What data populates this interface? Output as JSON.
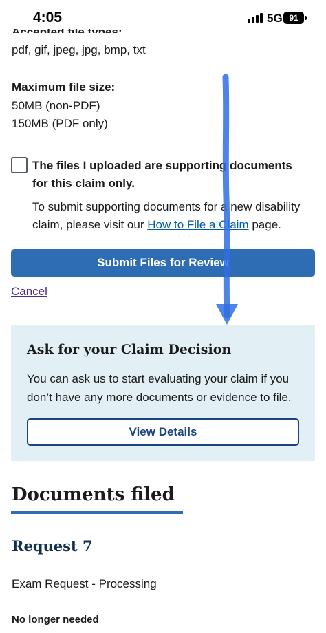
{
  "status_bar": {
    "time": "4:05",
    "network": "5G",
    "battery": "91"
  },
  "upload": {
    "accepted_types_label": "Accepted file types:",
    "accepted_types_value": "pdf, gif, jpeg, jpg, bmp, txt",
    "max_size_label": "Maximum file size:",
    "max_size_non_pdf": "50MB (non-PDF)",
    "max_size_pdf": "150MB (PDF only)",
    "checkbox_label": "The files I uploaded are supporting documents for this claim only.",
    "hint_prefix": "To submit supporting documents for a new disability claim, please visit our ",
    "hint_link": "How to File a Claim",
    "hint_suffix": " page.",
    "submit_label": "Submit Files for Review",
    "cancel_label": "Cancel"
  },
  "claim_decision": {
    "title": "Ask for your Claim Decision",
    "body": "You can ask us to start evaluating your claim if you don’t have any more documents or evidence to file.",
    "button_label": "View Details"
  },
  "documents": {
    "heading": "Documents filed",
    "request_title": "Request 7",
    "request_status": "Exam Request - Processing",
    "request_note": "No longer needed"
  },
  "colors": {
    "primary": "#2e6db4",
    "info_bg": "#e2eff5",
    "link": "#005ea2",
    "visited": "#4c2c92",
    "annotation": "#2f6fe0"
  }
}
